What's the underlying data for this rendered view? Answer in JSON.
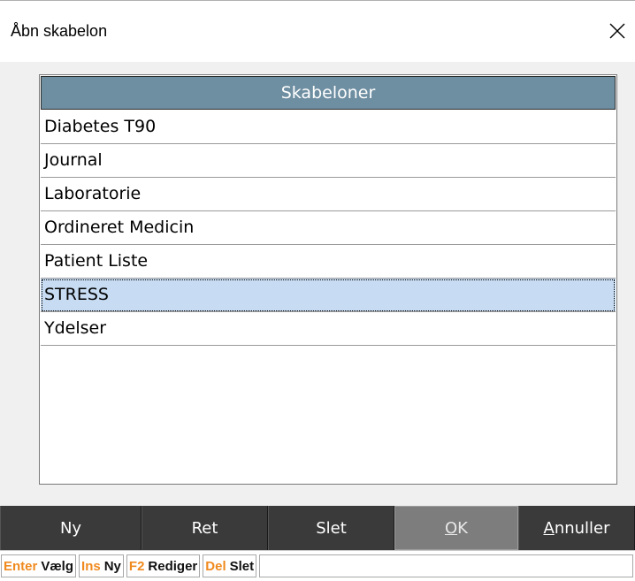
{
  "dialog": {
    "title": "Åbn skabelon",
    "close_icon": "close-icon"
  },
  "list": {
    "header": "Skabeloner",
    "items": [
      {
        "label": "Diabetes T90",
        "selected": false
      },
      {
        "label": "Journal",
        "selected": false
      },
      {
        "label": "Laboratorie",
        "selected": false
      },
      {
        "label": "Ordineret Medicin",
        "selected": false
      },
      {
        "label": "Patient Liste",
        "selected": false
      },
      {
        "label": "STRESS",
        "selected": true
      },
      {
        "label": "Ydelser",
        "selected": false
      }
    ]
  },
  "buttons": {
    "new_label": "Ny",
    "edit_label": "Ret",
    "delete_label": "Slet",
    "ok_mnemonic": "O",
    "ok_rest": "K",
    "cancel_mnemonic": "A",
    "cancel_rest": "nnuller"
  },
  "shortcuts": [
    {
      "key": "Enter",
      "action": "Vælg"
    },
    {
      "key": "Ins",
      "action": "Ny"
    },
    {
      "key": "F2",
      "action": "Rediger"
    },
    {
      "key": "Del",
      "action": "Slet"
    }
  ],
  "colors": {
    "header_bg": "#6e8ea1",
    "selected_row": "#c7dcf3",
    "button_bar": "#3a3a3a",
    "ok_button": "#7d7d7d",
    "shortcut_key": "#f08a1e"
  }
}
